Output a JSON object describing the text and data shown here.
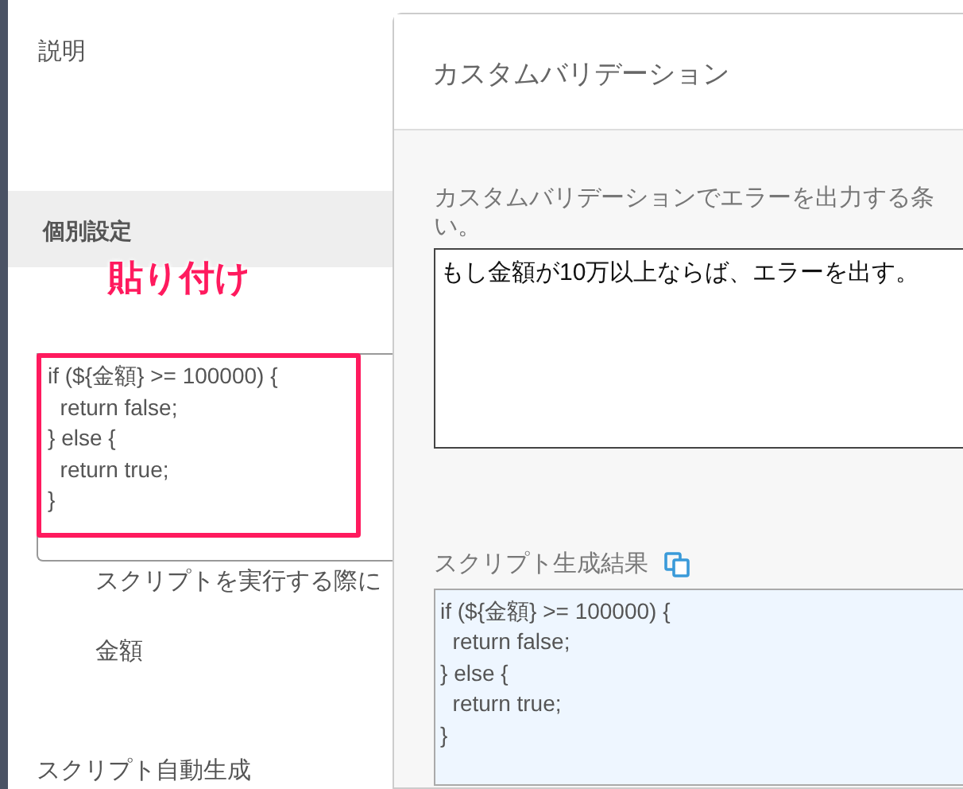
{
  "left_panel": {
    "description_label": "説明",
    "section_title": "個別設定",
    "annotation": "貼り付け",
    "script_lines": [
      "if (${金額} >= 100000) {",
      "  return false;",
      "} else {",
      "  return true;",
      "}"
    ],
    "hint": "スクリプトを実行する際に",
    "variable": "金額",
    "auto_generate_label": "スクリプト自動生成"
  },
  "dialog": {
    "title": "カスタムバリデーション",
    "condition_label_lines": [
      "カスタムバリデーションでエラーを出力する条",
      "い。"
    ],
    "condition_value": "もし金額が10万以上ならば、エラーを出す。",
    "result_label": "スクリプト生成結果",
    "result_lines": [
      "if (${金額} >= 100000) {",
      "  return false;",
      "} else {",
      "  return true;",
      "}"
    ]
  }
}
